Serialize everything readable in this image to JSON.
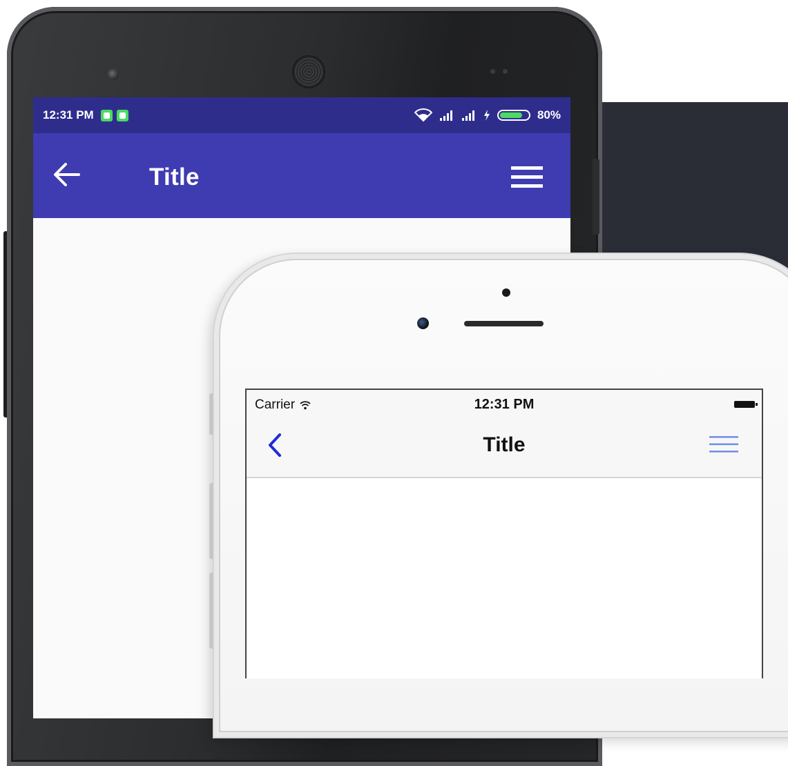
{
  "android": {
    "status_bar": {
      "time": "12:31 PM",
      "battery_percent": "80%",
      "battery_level": 0.8,
      "icons": [
        "notification-icon",
        "notification-icon",
        "wifi-icon",
        "signal-icon",
        "signal-icon",
        "charging-icon",
        "battery-icon"
      ]
    },
    "app_bar": {
      "title": "Title",
      "back_icon": "arrow-left-icon",
      "menu_icon": "hamburger-menu-icon",
      "color": "#3f3bb0"
    },
    "status_bar_color": "#2f2d8c"
  },
  "ios": {
    "status_bar": {
      "carrier": "Carrier",
      "time": "12:31 PM",
      "icons": [
        "wifi-icon",
        "battery-icon"
      ]
    },
    "nav_bar": {
      "title": "Title",
      "back_icon": "chevron-left-icon",
      "menu_icon": "hamburger-menu-icon",
      "tint_color": "#1f2bd6"
    }
  }
}
